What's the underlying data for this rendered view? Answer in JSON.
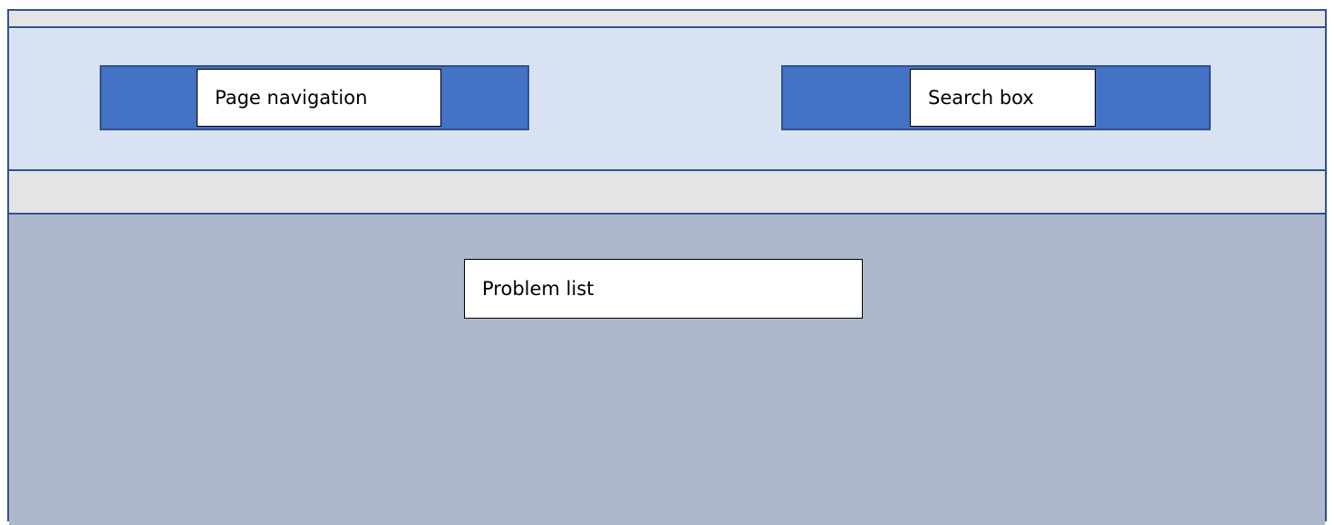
{
  "header": {
    "page_navigation": {
      "label": "Page navigation"
    },
    "search_box": {
      "label": "Search box"
    }
  },
  "content": {
    "problem_list": {
      "label": "Problem list"
    }
  },
  "colors": {
    "frame_border": "#2f528f",
    "header_background": "#d9e2f3",
    "bar_fill": "#4472c4",
    "content_background": "#adb9ca",
    "strip_background": "#e4e4e6"
  }
}
